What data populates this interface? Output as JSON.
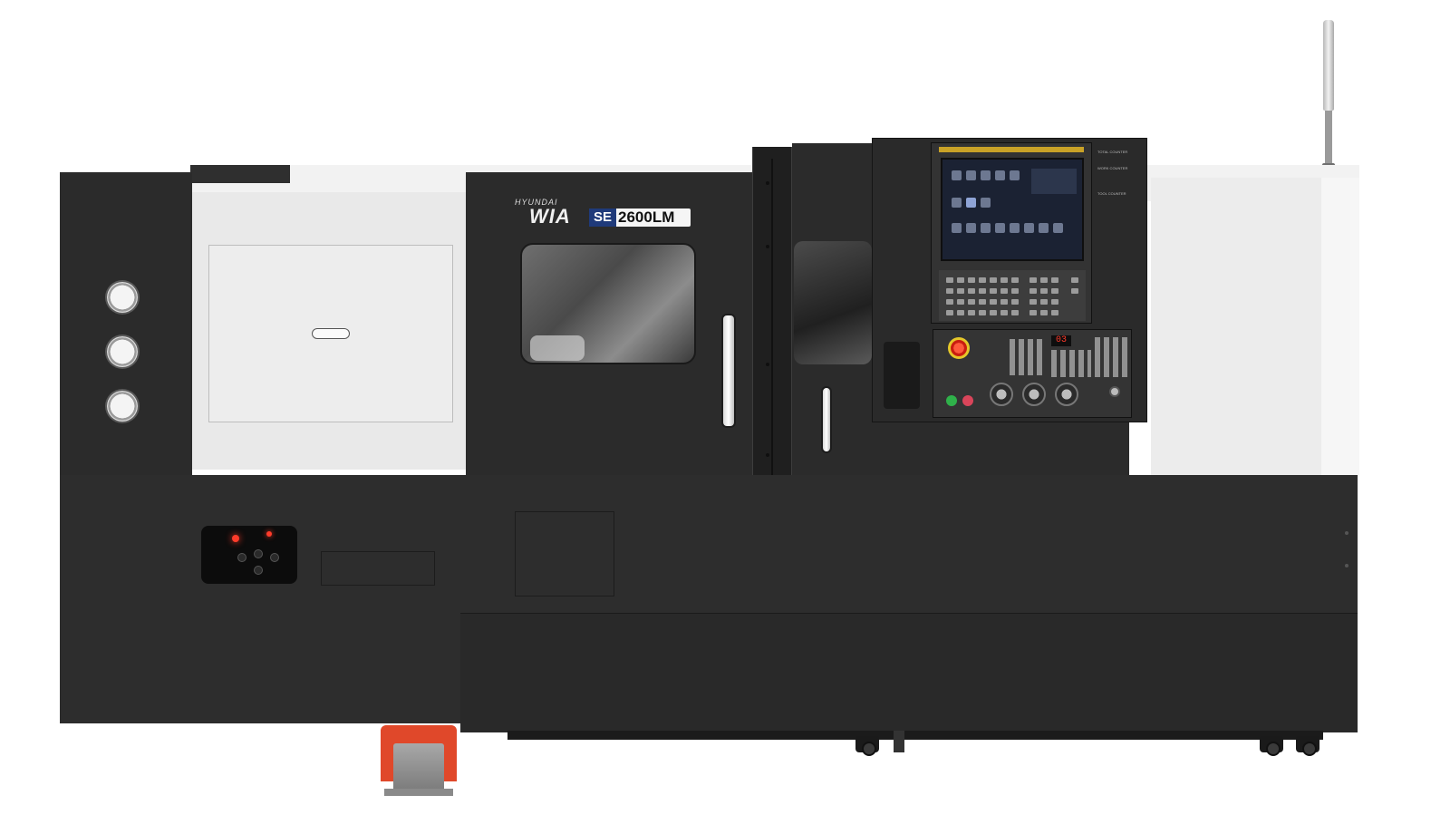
{
  "brand": {
    "maker": "HYUNDAI",
    "logo": "WIA",
    "series": "SE",
    "model": "2600LM"
  },
  "control_panel": {
    "spindle_display": "03",
    "side_labels": [
      "TOTAL COUNTER",
      "WORK COUNTER",
      "TOOL COUNTER"
    ]
  },
  "colors": {
    "body": "#2b2b2b",
    "guard": "#e9e9e9",
    "emergency_stop": "#e02a1c",
    "foot_pedal": "#e0482a",
    "screen": "#1b2233"
  },
  "icons": [
    "pressure-gauge-icon",
    "emergency-stop-icon",
    "foot-pedal-icon",
    "signal-tower-icon"
  ]
}
